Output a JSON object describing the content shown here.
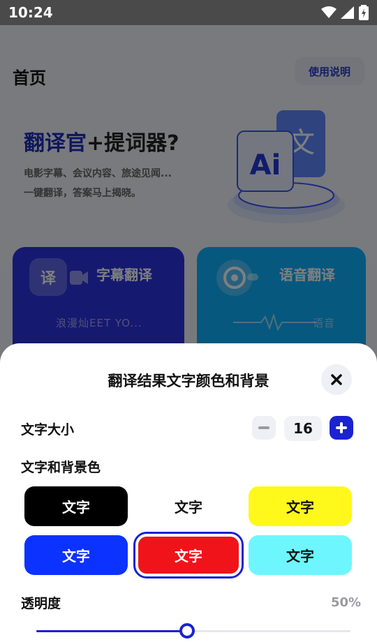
{
  "status_bar": {
    "time": "10:24"
  },
  "home": {
    "title": "首页",
    "help_button": "使用说明",
    "banner": {
      "title_part1": "翻译官",
      "title_plus": "+",
      "title_part2": "提词器?",
      "subtitle_line1": "电影字幕、会议内容、旅途见闻...",
      "subtitle_line2": "一键翻译，答案马上揭晓。"
    },
    "cards": [
      {
        "chip": "译",
        "label": "字幕翻译",
        "preview": "浪漫灿EET YO..."
      },
      {
        "label": "语音翻译",
        "preview": "语音"
      }
    ]
  },
  "sheet": {
    "title": "翻译结果文字颜色和背景",
    "font_size_label": "文字大小",
    "font_size_value": "16",
    "colors_label": "文字和背景色",
    "swatches": [
      {
        "label": "文字",
        "bg": "#000000",
        "fg": "#ffffff",
        "selected": false
      },
      {
        "label": "文字",
        "bg": "#ffffff",
        "fg": "#111111",
        "selected": false
      },
      {
        "label": "文字",
        "bg": "#fff81a",
        "fg": "#111111",
        "selected": false
      },
      {
        "label": "文字",
        "bg": "#0c32ff",
        "fg": "#ffffff",
        "selected": false
      },
      {
        "label": "文字",
        "bg": "#f0141a",
        "fg": "#ffffff",
        "selected": true
      },
      {
        "label": "文字",
        "bg": "#6ef6ff",
        "fg": "#111111",
        "selected": false
      }
    ],
    "opacity_label": "透明度",
    "opacity_value": "50%",
    "opacity_fraction": 0.48
  },
  "colors": {
    "accent": "#1a22d2",
    "card_subtitle": "#2a33e0",
    "card_voice": "#0fb0ff"
  }
}
